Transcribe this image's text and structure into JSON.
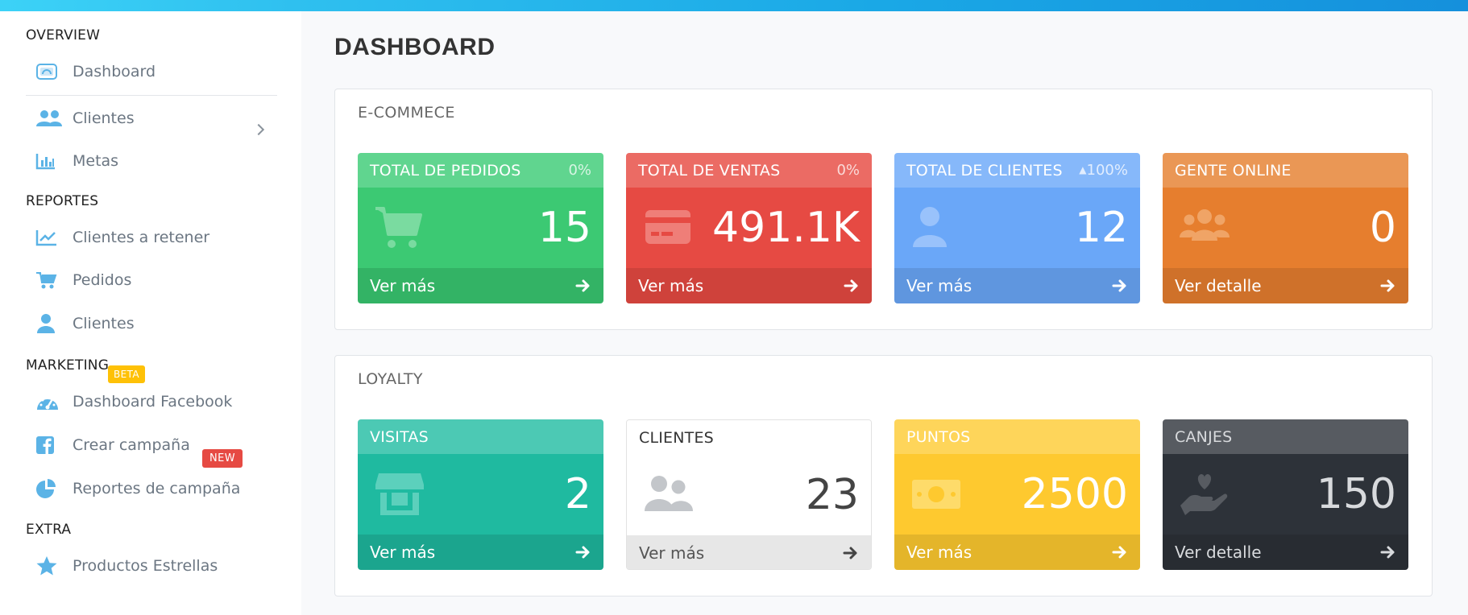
{
  "sidebar": {
    "sections": {
      "overview": "OVERVIEW",
      "reportes": "REPORTES",
      "marketing": "MARKETING",
      "extra": "EXTRA"
    },
    "items": [
      {
        "label": "Dashboard",
        "icon": "dashboard-icon"
      },
      {
        "label": "Clientes",
        "icon": "users-icon"
      },
      {
        "label": "Metas",
        "icon": "bar-chart-icon"
      },
      {
        "label": "Clientes a retener",
        "icon": "line-chart-icon"
      },
      {
        "label": "Pedidos",
        "icon": "cart-icon"
      },
      {
        "label": "Clientes",
        "icon": "user-icon"
      },
      {
        "label": "Dashboard Facebook",
        "icon": "gauge-icon"
      },
      {
        "label": "Crear campaña",
        "icon": "facebook-icon"
      },
      {
        "label": "Reportes de campaña",
        "icon": "pie-chart-icon"
      },
      {
        "label": "Productos Estrellas",
        "icon": "star-icon"
      }
    ],
    "badge_beta": "BETA",
    "badge_new": "NEW"
  },
  "main": {
    "title": "DASHBOARD",
    "ecommerce": {
      "title": "E-COMMECE",
      "cards": [
        {
          "label": "TOTAL DE PEDIDOS",
          "pct": "0%",
          "value": "15",
          "footer": "Ver más",
          "icon": "cart-icon"
        },
        {
          "label": "TOTAL DE VENTAS",
          "pct": "0%",
          "value": "491.1K",
          "footer": "Ver más",
          "icon": "credit-card-icon"
        },
        {
          "label": "TOTAL DE CLIENTES",
          "pct": "100%",
          "value": "12",
          "footer": "Ver más",
          "icon": "user-icon"
        },
        {
          "label": "GENTE ONLINE",
          "value": "0",
          "footer": "Ver detalle",
          "icon": "users-group-icon"
        }
      ]
    },
    "loyalty": {
      "title": "LOYALTY",
      "cards": [
        {
          "label": "VISITAS",
          "value": "2",
          "footer": "Ver más",
          "icon": "store-icon"
        },
        {
          "label": "CLIENTES",
          "value": "23",
          "footer": "Ver más",
          "icon": "users-icon"
        },
        {
          "label": "PUNTOS",
          "value": "2500",
          "footer": "Ver más",
          "icon": "money-bill-icon"
        },
        {
          "label": "CANJES",
          "value": "150",
          "footer": "Ver detalle",
          "icon": "hand-heart-icon"
        }
      ]
    }
  },
  "colors": {
    "sidebar_icon": "#5bb3e6",
    "green": "#3cc973",
    "red": "#e64a43",
    "blue": "#6aa7f8",
    "orange": "#e67e2e",
    "teal": "#1fbaa0",
    "white_card": "#ffffff",
    "yellow": "#fec92f",
    "dark": "#2d3239"
  }
}
